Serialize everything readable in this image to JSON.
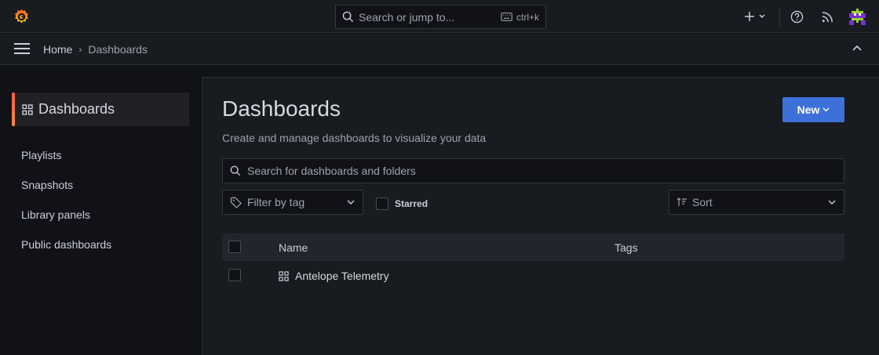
{
  "topbar": {
    "search_placeholder": "Search or jump to...",
    "search_shortcut": "ctrl+k",
    "icons": [
      "grafana-logo",
      "search-icon",
      "keyboard-icon",
      "plus-icon",
      "chevron-down-icon",
      "help-icon",
      "rss-icon",
      "avatar"
    ]
  },
  "breadcrumb": {
    "home": "Home",
    "separator": "›",
    "current": "Dashboards"
  },
  "sidebar": {
    "active": "Dashboards",
    "items": [
      {
        "label": "Playlists"
      },
      {
        "label": "Snapshots"
      },
      {
        "label": "Library panels"
      },
      {
        "label": "Public dashboards"
      }
    ]
  },
  "main": {
    "title": "Dashboards",
    "subtitle": "Create and manage dashboards to visualize your data",
    "new_button": "New",
    "search_placeholder": "Search for dashboards and folders",
    "tag_filter_placeholder": "Filter by tag",
    "starred_label": "Starred",
    "sort_label": "Sort",
    "table": {
      "columns": [
        "Name",
        "Tags"
      ],
      "rows": [
        {
          "name": "Antelope Telemetry",
          "tags": ""
        }
      ]
    }
  },
  "colors": {
    "background": "#111217",
    "surface": "#181b1f",
    "accent": "#3d71d9",
    "active_indicator": "#ff7a30"
  }
}
